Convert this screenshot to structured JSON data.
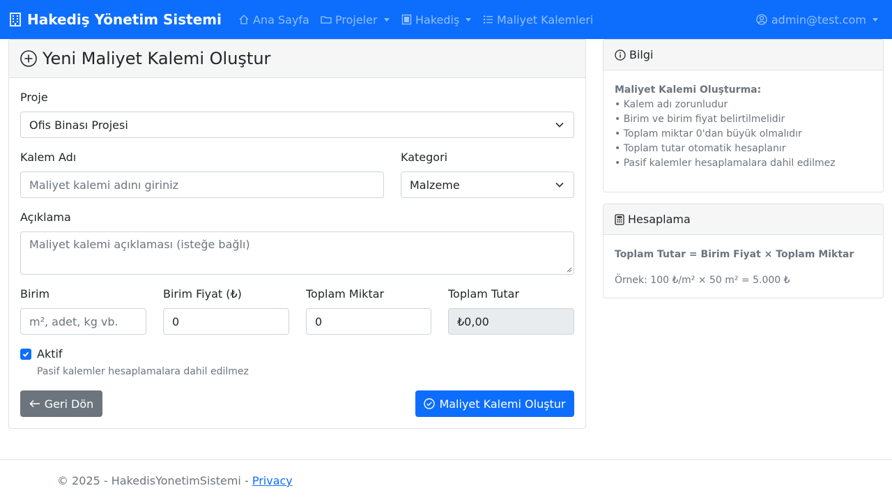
{
  "navbar": {
    "brand": "Hakediş Yönetim Sistemi",
    "items": [
      {
        "label": "Ana Sayfa",
        "icon": "house-icon"
      },
      {
        "label": "Projeler",
        "icon": "folder-icon",
        "dropdown": true
      },
      {
        "label": "Hakediş",
        "icon": "journal-icon",
        "dropdown": true
      },
      {
        "label": "Maliyet Kalemleri",
        "icon": "list-icon"
      }
    ],
    "user": "admin@test.com"
  },
  "form": {
    "title": "Yeni Maliyet Kalemi Oluştur",
    "project_label": "Proje",
    "project_value": "Ofis Binası Projesi",
    "name_label": "Kalem Adı",
    "name_placeholder": "Maliyet kalemi adını giriniz",
    "category_label": "Kategori",
    "category_value": "Malzeme",
    "description_label": "Açıklama",
    "description_placeholder": "Maliyet kalemi açıklaması (isteğe bağlı)",
    "unit_label": "Birim",
    "unit_placeholder": "m², adet, kg vb.",
    "unit_price_label": "Birim Fiyat (₺)",
    "unit_price_value": "0",
    "quantity_label": "Toplam Miktar",
    "quantity_value": "0",
    "total_label": "Toplam Tutar",
    "total_value": "₺0,00",
    "active_label": "Aktif",
    "active_checked": true,
    "active_help": "Pasif kalemler hesaplamalara dahil edilmez",
    "back_button": "Geri Dön",
    "submit_button": "Maliyet Kalemi Oluştur"
  },
  "info_card": {
    "title": "Bilgi",
    "heading": "Maliyet Kalemi Oluşturma:",
    "items": [
      "• Kalem adı zorunludur",
      "• Birim ve birim fiyat belirtilmelidir",
      "• Toplam miktar 0'dan büyük olmalıdır",
      "• Toplam tutar otomatik hesaplanır",
      "• Pasif kalemler hesaplamalara dahil edilmez"
    ]
  },
  "calc_card": {
    "title": "Hesaplama",
    "formula": "Toplam Tutar = Birim Fiyat × Toplam Miktar",
    "example": "Örnek: 100 ₺/m² × 50 m² = 5.000 ₺"
  },
  "footer": {
    "text": "© 2025 - HakedisYonetimSistemi - ",
    "link": "Privacy"
  },
  "colors": {
    "primary": "#0d6efd",
    "secondary": "#6c757d",
    "muted": "#6c757d"
  }
}
